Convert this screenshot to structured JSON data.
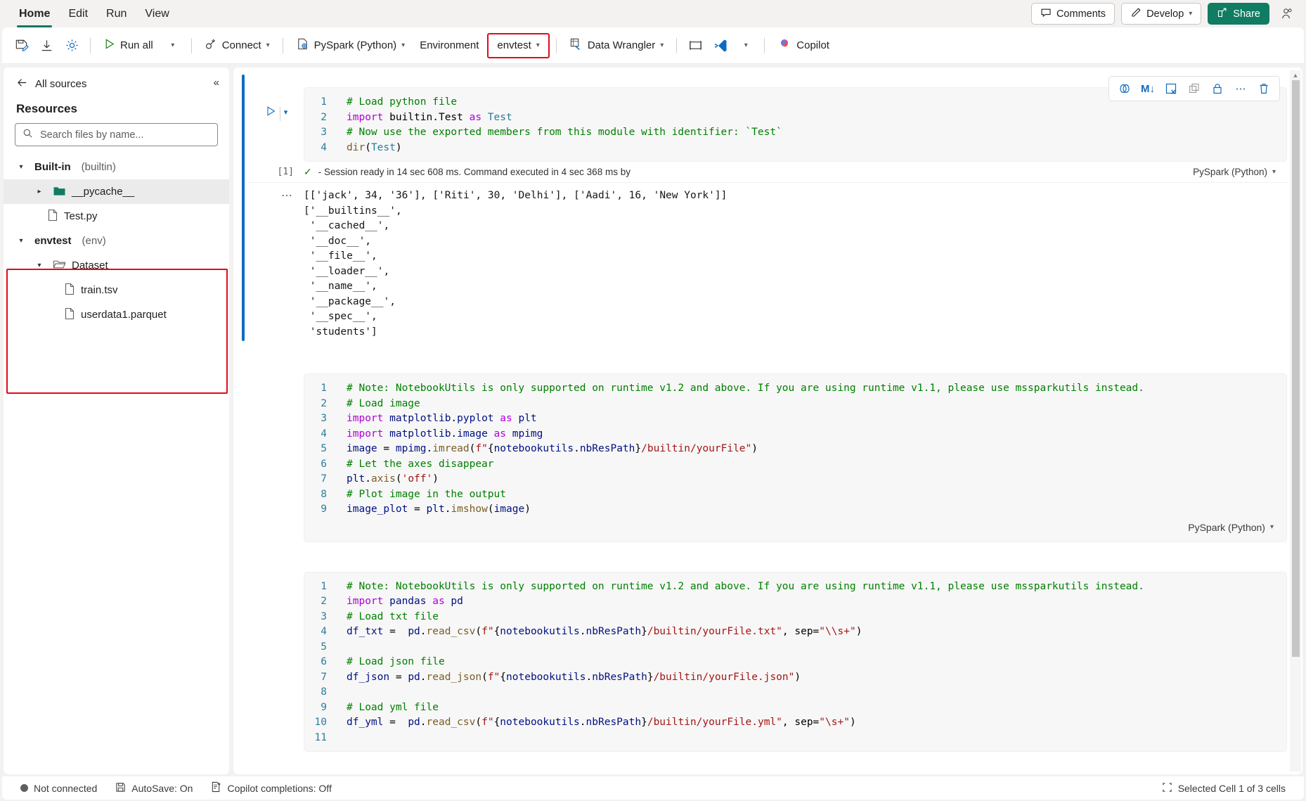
{
  "ribbon": {
    "tabs": [
      {
        "label": "Home",
        "active": true
      },
      {
        "label": "Edit",
        "active": false
      },
      {
        "label": "Run",
        "active": false
      },
      {
        "label": "View",
        "active": false
      }
    ],
    "comments_label": "Comments",
    "develop_label": "Develop",
    "share_label": "Share"
  },
  "toolbar": {
    "save_icon": "save-edit-icon",
    "download_icon": "download-icon",
    "settings_icon": "gear-icon",
    "run_all_label": "Run all",
    "connect_label": "Connect",
    "language_label": "PySpark (Python)",
    "environment_label": "Environment",
    "env_name": "envtest",
    "data_wrangler_label": "Data Wrangler",
    "layout_icon": "layout-icon",
    "vscode_icon": "vscode-icon",
    "copilot_label": "Copilot"
  },
  "sidebar": {
    "back_label": "All sources",
    "title": "Resources",
    "collapse_icon": "chevron-double-left-icon",
    "search_placeholder": "Search files by name...",
    "search_value": "",
    "tree": [
      {
        "type": "group",
        "name": "Built-in",
        "sub": "(builtin)",
        "expanded": true,
        "indent": 0,
        "selected": false
      },
      {
        "type": "folder",
        "name": "__pycache__",
        "expanded": false,
        "indent": 1,
        "selected": true
      },
      {
        "type": "file",
        "name": "Test.py",
        "indent": 2,
        "selected": false
      },
      {
        "type": "group",
        "name": "envtest",
        "sub": "(env)",
        "expanded": true,
        "indent": 0,
        "selected": false
      },
      {
        "type": "folder",
        "name": "Dataset",
        "expanded": true,
        "indent": 1,
        "selected": false
      },
      {
        "type": "file",
        "name": "train.tsv",
        "indent": 2,
        "selected": false
      },
      {
        "type": "file",
        "name": "userdata1.parquet",
        "indent": 2,
        "selected": false
      }
    ]
  },
  "cell_toolbar": {
    "icons": [
      {
        "name": "code-toggle-icon",
        "glyph": "⧉"
      },
      {
        "name": "markdown-icon",
        "glyph": "M↓"
      },
      {
        "name": "clear-output-icon",
        "glyph": "⊠"
      },
      {
        "name": "copy-icon",
        "glyph": "❐"
      },
      {
        "name": "lock-icon",
        "glyph": "□"
      },
      {
        "name": "more-options-icon",
        "glyph": "⋯"
      },
      {
        "name": "delete-icon",
        "glyph": "🗑"
      }
    ]
  },
  "cells": [
    {
      "index": 1,
      "active": true,
      "exec_count": "[1]",
      "lines": [
        [
          {
            "t": "com",
            "s": "# Load python file"
          }
        ],
        [
          {
            "t": "kw",
            "s": "import"
          },
          {
            "t": "pln",
            "s": " builtin.Test "
          },
          {
            "t": "kw",
            "s": "as"
          },
          {
            "t": "cls",
            "s": " Test"
          }
        ],
        [
          {
            "t": "com",
            "s": "# Now use the exported members from this module with identifier: `Test`"
          }
        ],
        [
          {
            "t": "fn",
            "s": "dir"
          },
          {
            "t": "pln",
            "s": "("
          },
          {
            "t": "cls",
            "s": "Test"
          },
          {
            "t": "pln",
            "s": ")"
          }
        ]
      ],
      "status": "- Session ready in 14 sec 608 ms. Command executed in 4 sec 368 ms by",
      "language": "PySpark (Python)",
      "output": "[['jack', 34, '36'], ['Riti', 30, 'Delhi'], ['Aadi', 16, 'New York']]\n['__builtins__',\n '__cached__',\n '__doc__',\n '__file__',\n '__loader__',\n '__name__',\n '__package__',\n '__spec__',\n 'students']"
    },
    {
      "index": 2,
      "active": false,
      "lines": [
        [
          {
            "t": "com",
            "s": "# Note: NotebookUtils is only supported on runtime v1.2 and above. If you are using runtime v1.1, please use mssparkutils instead."
          }
        ],
        [
          {
            "t": "com",
            "s": "# Load image"
          }
        ],
        [
          {
            "t": "kw",
            "s": "import"
          },
          {
            "t": "var",
            "s": " matplotlib"
          },
          {
            "t": "pln",
            "s": "."
          },
          {
            "t": "var",
            "s": "pyplot "
          },
          {
            "t": "kw",
            "s": "as"
          },
          {
            "t": "var",
            "s": " plt"
          }
        ],
        [
          {
            "t": "kw",
            "s": "import"
          },
          {
            "t": "var",
            "s": " matplotlib"
          },
          {
            "t": "pln",
            "s": "."
          },
          {
            "t": "var",
            "s": "image "
          },
          {
            "t": "kw",
            "s": "as"
          },
          {
            "t": "var",
            "s": " mpimg"
          }
        ],
        [
          {
            "t": "var",
            "s": "image"
          },
          {
            "t": "pln",
            "s": " = "
          },
          {
            "t": "var",
            "s": "mpimg"
          },
          {
            "t": "pln",
            "s": "."
          },
          {
            "t": "fn",
            "s": "imread"
          },
          {
            "t": "pln",
            "s": "("
          },
          {
            "t": "str",
            "s": "f\""
          },
          {
            "t": "pln",
            "s": "{"
          },
          {
            "t": "var",
            "s": "notebookutils"
          },
          {
            "t": "pln",
            "s": "."
          },
          {
            "t": "var",
            "s": "nbResPath"
          },
          {
            "t": "pln",
            "s": "}"
          },
          {
            "t": "str",
            "s": "/builtin/yourFile\""
          },
          {
            "t": "pln",
            "s": ")"
          }
        ],
        [
          {
            "t": "com",
            "s": "# Let the axes disappear"
          }
        ],
        [
          {
            "t": "var",
            "s": "plt"
          },
          {
            "t": "pln",
            "s": "."
          },
          {
            "t": "fn",
            "s": "axis"
          },
          {
            "t": "pln",
            "s": "("
          },
          {
            "t": "str",
            "s": "'off'"
          },
          {
            "t": "pln",
            "s": ")"
          }
        ],
        [
          {
            "t": "com",
            "s": "# Plot image in the output"
          }
        ],
        [
          {
            "t": "var",
            "s": "image_plot"
          },
          {
            "t": "pln",
            "s": " = "
          },
          {
            "t": "var",
            "s": "plt"
          },
          {
            "t": "pln",
            "s": "."
          },
          {
            "t": "fn",
            "s": "imshow"
          },
          {
            "t": "pln",
            "s": "("
          },
          {
            "t": "var",
            "s": "image"
          },
          {
            "t": "pln",
            "s": ")"
          }
        ]
      ],
      "language": "PySpark (Python)"
    },
    {
      "index": 3,
      "active": false,
      "lines": [
        [
          {
            "t": "com",
            "s": "# Note: NotebookUtils is only supported on runtime v1.2 and above. If you are using runtime v1.1, please use mssparkutils instead."
          }
        ],
        [
          {
            "t": "kw",
            "s": "import"
          },
          {
            "t": "var",
            "s": " pandas "
          },
          {
            "t": "kw",
            "s": "as"
          },
          {
            "t": "var",
            "s": " pd"
          }
        ],
        [
          {
            "t": "com",
            "s": "# Load txt file"
          }
        ],
        [
          {
            "t": "var",
            "s": "df_txt"
          },
          {
            "t": "pln",
            "s": " =  "
          },
          {
            "t": "var",
            "s": "pd"
          },
          {
            "t": "pln",
            "s": "."
          },
          {
            "t": "fn",
            "s": "read_csv"
          },
          {
            "t": "pln",
            "s": "("
          },
          {
            "t": "str",
            "s": "f\""
          },
          {
            "t": "pln",
            "s": "{"
          },
          {
            "t": "var",
            "s": "notebookutils"
          },
          {
            "t": "pln",
            "s": "."
          },
          {
            "t": "var",
            "s": "nbResPath"
          },
          {
            "t": "pln",
            "s": "}"
          },
          {
            "t": "str",
            "s": "/builtin/yourFile.txt\""
          },
          {
            "t": "pln",
            "s": ", sep="
          },
          {
            "t": "str",
            "s": "\"\\\\s+\""
          },
          {
            "t": "pln",
            "s": ")"
          }
        ],
        [],
        [
          {
            "t": "com",
            "s": "# Load json file"
          }
        ],
        [
          {
            "t": "var",
            "s": "df_json"
          },
          {
            "t": "pln",
            "s": " = "
          },
          {
            "t": "var",
            "s": "pd"
          },
          {
            "t": "pln",
            "s": "."
          },
          {
            "t": "fn",
            "s": "read_json"
          },
          {
            "t": "pln",
            "s": "("
          },
          {
            "t": "str",
            "s": "f\""
          },
          {
            "t": "pln",
            "s": "{"
          },
          {
            "t": "var",
            "s": "notebookutils"
          },
          {
            "t": "pln",
            "s": "."
          },
          {
            "t": "var",
            "s": "nbResPath"
          },
          {
            "t": "pln",
            "s": "}"
          },
          {
            "t": "str",
            "s": "/builtin/yourFile.json\""
          },
          {
            "t": "pln",
            "s": ")"
          }
        ],
        [],
        [
          {
            "t": "com",
            "s": "# Load yml file"
          }
        ],
        [
          {
            "t": "var",
            "s": "df_yml"
          },
          {
            "t": "pln",
            "s": " =  "
          },
          {
            "t": "var",
            "s": "pd"
          },
          {
            "t": "pln",
            "s": "."
          },
          {
            "t": "fn",
            "s": "read_csv"
          },
          {
            "t": "pln",
            "s": "("
          },
          {
            "t": "str",
            "s": "f\""
          },
          {
            "t": "pln",
            "s": "{"
          },
          {
            "t": "var",
            "s": "notebookutils"
          },
          {
            "t": "pln",
            "s": "."
          },
          {
            "t": "var",
            "s": "nbResPath"
          },
          {
            "t": "pln",
            "s": "}"
          },
          {
            "t": "str",
            "s": "/builtin/yourFile.yml\""
          },
          {
            "t": "pln",
            "s": ", sep="
          },
          {
            "t": "str",
            "s": "\"\\s+\""
          },
          {
            "t": "pln",
            "s": ")"
          }
        ],
        []
      ]
    }
  ],
  "statusbar": {
    "connection": "Not connected",
    "autosave": "AutoSave: On",
    "copilot": "Copilot completions: Off",
    "selection": "Selected Cell 1 of 3 cells"
  },
  "colors": {
    "accent_blue": "#0f6cbd",
    "brand_green": "#107c62",
    "highlight_red": "#e00b1c",
    "comment_green": "#008000",
    "keyword_purple": "#af00db",
    "string_red": "#a31515"
  }
}
